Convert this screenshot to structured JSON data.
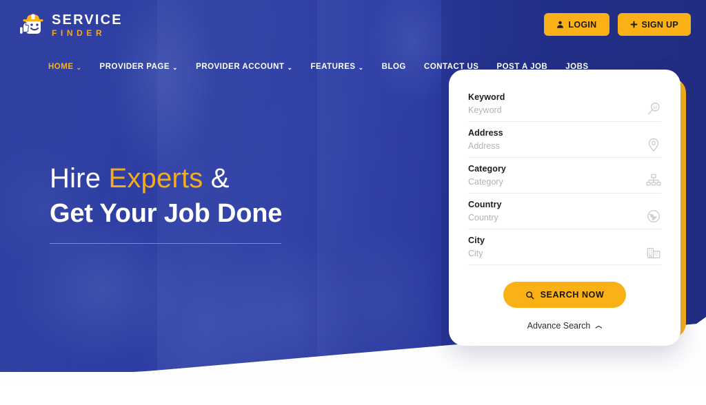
{
  "brand": {
    "line1": "SERVICE",
    "line2": "FINDER",
    "icon": "hardhat-thumbsup-logo",
    "accent_color": "#f9b115",
    "navy_color": "#2b3a9e"
  },
  "header": {
    "login_label": "LOGIN",
    "login_icon": "user-icon",
    "signup_label": "SIGN UP",
    "signup_icon": "plus-icon"
  },
  "nav": {
    "items": [
      {
        "label": "HOME",
        "has_dropdown": true,
        "active": true,
        "underlined": false
      },
      {
        "label": "PROVIDER PAGE",
        "has_dropdown": true,
        "active": false,
        "underlined": false
      },
      {
        "label": "PROVIDER ACCOUNT",
        "has_dropdown": true,
        "active": false,
        "underlined": false
      },
      {
        "label": "FEATURES",
        "has_dropdown": true,
        "active": false,
        "underlined": false
      },
      {
        "label": "BLOG",
        "has_dropdown": false,
        "active": false,
        "underlined": false
      },
      {
        "label": "CONTACT US",
        "has_dropdown": false,
        "active": false,
        "underlined": false
      },
      {
        "label": "POST A JOB",
        "has_dropdown": false,
        "active": false,
        "underlined": false
      },
      {
        "label": "JOBS",
        "has_dropdown": false,
        "active": false,
        "underlined": true
      }
    ],
    "chevron_glyph": "⌄"
  },
  "hero": {
    "headline_part1": "Hire ",
    "headline_accent": "Experts",
    "headline_part2": " &",
    "headline_line2": "Get Your Job Done"
  },
  "search": {
    "fields": [
      {
        "label": "Keyword",
        "value": "",
        "placeholder": "Keyword",
        "icon": "magnifier-w-icon"
      },
      {
        "label": "Address",
        "value": "",
        "placeholder": "Address",
        "icon": "map-pin-icon"
      },
      {
        "label": "Category",
        "value": "",
        "placeholder": "Category",
        "icon": "sitemap-icon"
      },
      {
        "label": "Country",
        "value": "",
        "placeholder": "Country",
        "icon": "globe-icon"
      },
      {
        "label": "City",
        "value": "",
        "placeholder": "City",
        "icon": "buildings-icon"
      }
    ],
    "button_label": "SEARCH NOW",
    "button_icon": "search-icon",
    "advance_label": "Advance Search",
    "advance_caret": "︿"
  }
}
